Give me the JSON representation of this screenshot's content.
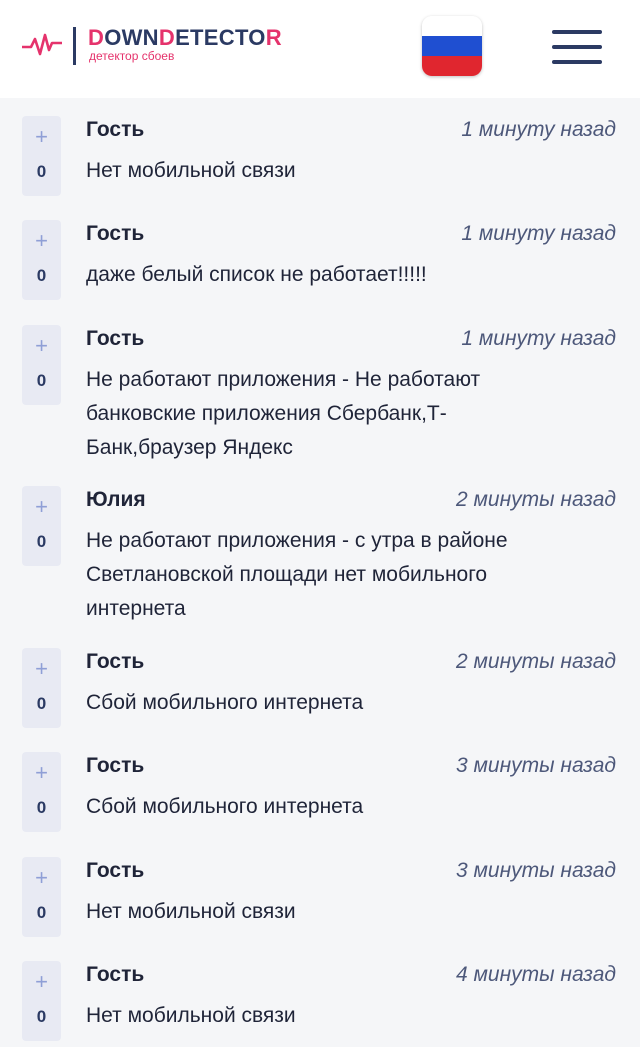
{
  "header": {
    "logo_prefix": "D",
    "logo_mid": "OWN",
    "logo_d2": "D",
    "logo_mid2": "ETECTO",
    "logo_end": "R",
    "logo_subtitle": "детектор сбоев",
    "accent_color": "#e5336c",
    "brand_color": "#2b3a63",
    "region_flag": "russia-flag-icon"
  },
  "comments": [
    {
      "author": "Гость",
      "time": "1 минуту назад",
      "votes": "0",
      "plus": "+",
      "text": "Нет мобильной связи"
    },
    {
      "author": "Гость",
      "time": "1 минуту назад",
      "votes": "0",
      "plus": "+",
      "text": "даже белый список не работает!!!!!"
    },
    {
      "author": "Гость",
      "time": "1 минуту назад",
      "votes": "0",
      "plus": "+",
      "text": "Не работают приложения - Не работают банковские приложения Сбербанк,Т-Банк,браузер Яндекс"
    },
    {
      "author": "Юлия",
      "time": "2 минуты назад",
      "votes": "0",
      "plus": "+",
      "text": "Не работают приложения - с утра в районе Светлановской площади нет мобильного интернета"
    },
    {
      "author": "Гость",
      "time": "2 минуты назад",
      "votes": "0",
      "plus": "+",
      "text": "Сбой мобильного интернета"
    },
    {
      "author": "Гость",
      "time": "3 минуты назад",
      "votes": "0",
      "plus": "+",
      "text": "Сбой мобильного интернета"
    },
    {
      "author": "Гость",
      "time": "3 минуты назад",
      "votes": "0",
      "plus": "+",
      "text": "Нет мобильной связи"
    },
    {
      "author": "Гость",
      "time": "4 минуты назад",
      "votes": "0",
      "plus": "+",
      "text": "Нет мобильной связи"
    }
  ]
}
